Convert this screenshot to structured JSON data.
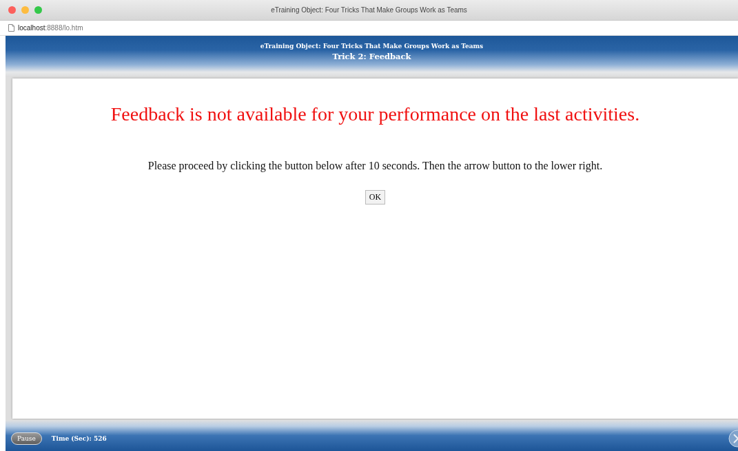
{
  "window": {
    "title": "eTraining Object: Four Tricks That Make Groups Work as Teams"
  },
  "address_bar": {
    "url": "**localhost**:8888/lo.htm"
  },
  "header": {
    "title": "eTraining Object: Four Tricks That Make Groups Work as Teams",
    "subtitle": "Trick 2: Feedback"
  },
  "content": {
    "heading": "Feedback is not available for your performance on the last activities.",
    "instruction": "Please proceed by clicking the button below after 10 seconds. Then the arrow button to the lower right.",
    "button": "OK"
  },
  "footer": {
    "pause_button": "Pause",
    "timer": "Time (Sec): 526"
  }
}
